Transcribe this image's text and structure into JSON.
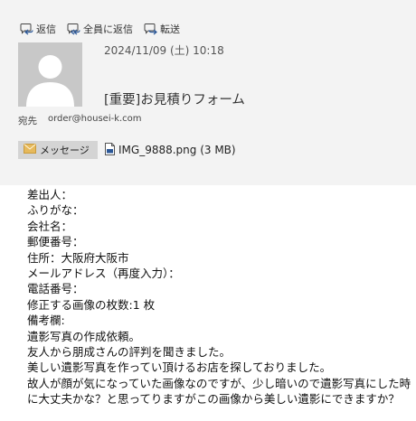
{
  "toolbar": {
    "reply_label": "返信",
    "reply_all_label": "全員に返信",
    "forward_label": "転送"
  },
  "message": {
    "date": "2024/11/09 (土) 10:18",
    "subject": "[重要]お見積りフォーム",
    "to_label": "宛先",
    "to_address": "order@housei-k.com"
  },
  "attachments": {
    "message_tab_label": "メッセージ",
    "file_name": "IMG_9888.png (3 MB)"
  },
  "body": {
    "lines": [
      "差出人：",
      "ふりがな：",
      "会社名：",
      "郵便番号：",
      "住所：大阪府大阪市",
      "メールアドレス（再度入力）：",
      "電話番号：",
      "修正する画像の枚数:1 枚",
      "備考欄:",
      "遺影写真の作成依頼。",
      "友人から朋成さんの評判を聞きました。",
      "美しい遺影写真を作ってい頂けるお店を探しておりました。",
      "故人が顔が気になっていた画像なのですが、少し暗いので遺影写真にした時に大丈夫かな？と思ってりますがこの画像から美しい遺影にできますか？"
    ]
  },
  "colors": {
    "header_background": "#f3f3f3",
    "avatar_background": "#c8c8c8",
    "attachment_tab_background": "#d4d4d4",
    "envelope_icon": "#e6b95c",
    "file_icon": "#2b5797"
  }
}
